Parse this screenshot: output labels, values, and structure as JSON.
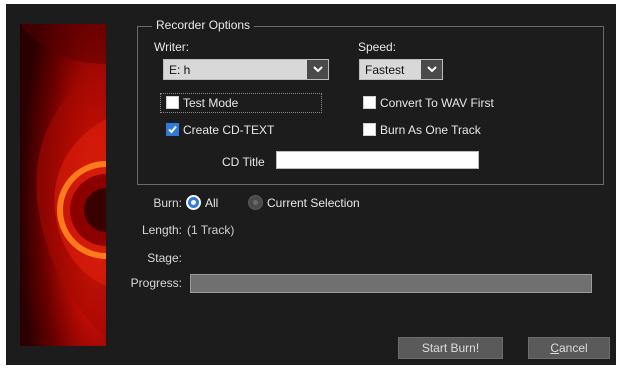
{
  "group": {
    "title": "Recorder Options"
  },
  "writer": {
    "label": "Writer:",
    "value": "E: h"
  },
  "speed": {
    "label": "Speed:",
    "value": "Fastest"
  },
  "options": {
    "test_mode": {
      "label": "Test Mode",
      "checked": false
    },
    "create_cd_text": {
      "label": "Create CD-TEXT",
      "checked": true
    },
    "convert_wav": {
      "label": "Convert To WAV First",
      "checked": false
    },
    "burn_one_track": {
      "label": "Burn As One Track",
      "checked": false
    }
  },
  "cd_title": {
    "label": "CD Title",
    "value": ""
  },
  "burn": {
    "label": "Burn:",
    "options": [
      {
        "label": "All",
        "selected": true
      },
      {
        "label": "Current Selection",
        "selected": false
      }
    ]
  },
  "length": {
    "label": "Length:",
    "value": "(1 Track)"
  },
  "stage": {
    "label": "Stage:",
    "value": ""
  },
  "progress": {
    "label": "Progress:",
    "fraction": 0
  },
  "buttons": {
    "start_burn": "Start Burn!",
    "cancel_first": "C",
    "cancel_rest": "ancel"
  },
  "colors": {
    "background": "#1c1c1c",
    "accent": "#2f7ad8",
    "disc_red": "#d11a0a"
  }
}
